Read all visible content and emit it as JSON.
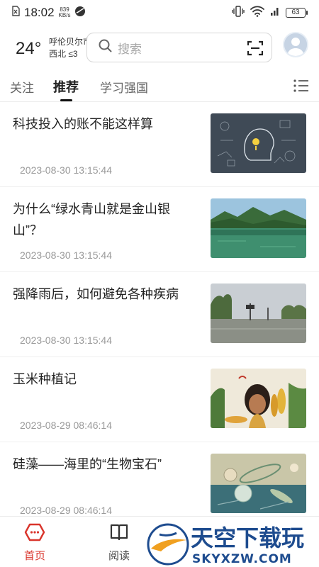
{
  "status_bar": {
    "time": "18:02",
    "net_speed_value": "839",
    "net_speed_unit": "KB/s",
    "battery": "63"
  },
  "header": {
    "temperature": "24°",
    "city": "呼伦贝尔市",
    "wind": "西北 ≤3",
    "search_placeholder": "搜索"
  },
  "tabs": [
    {
      "label": "关注",
      "active": false
    },
    {
      "label": "推荐",
      "active": true
    },
    {
      "label": "学习强国",
      "active": false
    }
  ],
  "feed": [
    {
      "title": "科技投入的账不能这样算",
      "time": "2023-08-30 13:15:44",
      "thumb": "tech-brain-illustration"
    },
    {
      "title": "为什么“绿水青山就是金山银山”？",
      "time": "2023-08-30 13:15:44",
      "thumb": "green-lake-mountains"
    },
    {
      "title": "强降雨后，如何避免各种疾病",
      "time": "2023-08-30 13:15:44",
      "thumb": "flooded-street"
    },
    {
      "title": "玉米种植记",
      "time": "2023-08-29 08:46:14",
      "thumb": "corn-painting"
    },
    {
      "title": "硅藻——海里的“生物宝石”",
      "time": "2023-08-29 08:46:14",
      "thumb": "diatoms-microscope"
    }
  ],
  "bottom_nav": {
    "home_label": "首页",
    "read_label": "阅读"
  },
  "watermark": {
    "brand": "天空下载玩",
    "domain": "SKYXZW.COM"
  },
  "colors": {
    "accent": "#d9342b",
    "text_primary": "#222222",
    "text_secondary": "#999999"
  }
}
